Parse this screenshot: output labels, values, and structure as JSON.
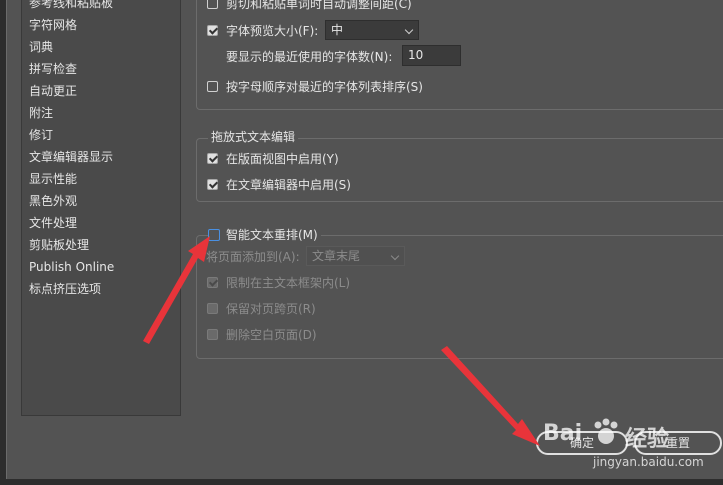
{
  "sidebar": {
    "items": [
      {
        "label": "参考线和粘贴板"
      },
      {
        "label": "字符网格"
      },
      {
        "label": "词典"
      },
      {
        "label": "拼写检查"
      },
      {
        "label": "自动更正"
      },
      {
        "label": "附注"
      },
      {
        "label": "修订"
      },
      {
        "label": "文章编辑器显示"
      },
      {
        "label": "显示性能"
      },
      {
        "label": "黑色外观"
      },
      {
        "label": "文件处理"
      },
      {
        "label": "剪贴板处理"
      },
      {
        "label": "Publish Online"
      },
      {
        "label": "标点挤压选项"
      }
    ]
  },
  "type_options": {
    "cut_paste_label": "剪切和粘贴单词时自动调整间距(C)",
    "font_preview_label": "字体预览大小(F):",
    "font_preview_value": "中",
    "recent_fonts_label": "要显示的最近使用的字体数(N):",
    "recent_fonts_value": "10",
    "sort_recent_label": "按字母顺序对最近的字体列表排序(S)"
  },
  "drag_drop": {
    "title": "拖放式文本编辑",
    "layout_view_label": "在版面视图中启用(Y)",
    "story_editor_label": "在文章编辑器中启用(S)"
  },
  "smart_reflow": {
    "title": "智能文本重排(M)",
    "add_pages_label": "将页面添加到(A):",
    "add_pages_value": "文章末尾",
    "limit_label": "限制在主文本框架内(L)",
    "preserve_label": "保留对页跨页(R)",
    "delete_empty_label": "删除空白页面(D)"
  },
  "buttons": {
    "ok_label": "确定",
    "reset_label": "重置"
  },
  "watermark": {
    "brand": "Bai",
    "brand2": "经验",
    "url": "jingyan.baidu.com"
  },
  "colors": {
    "background": "#535353",
    "arrow": "#e8343a",
    "checkbox_highlight": "#4a90e2"
  },
  "icons": [
    "checkbox",
    "chevron-down-icon",
    "red-arrow-icon",
    "baidu-paw-icon"
  ]
}
